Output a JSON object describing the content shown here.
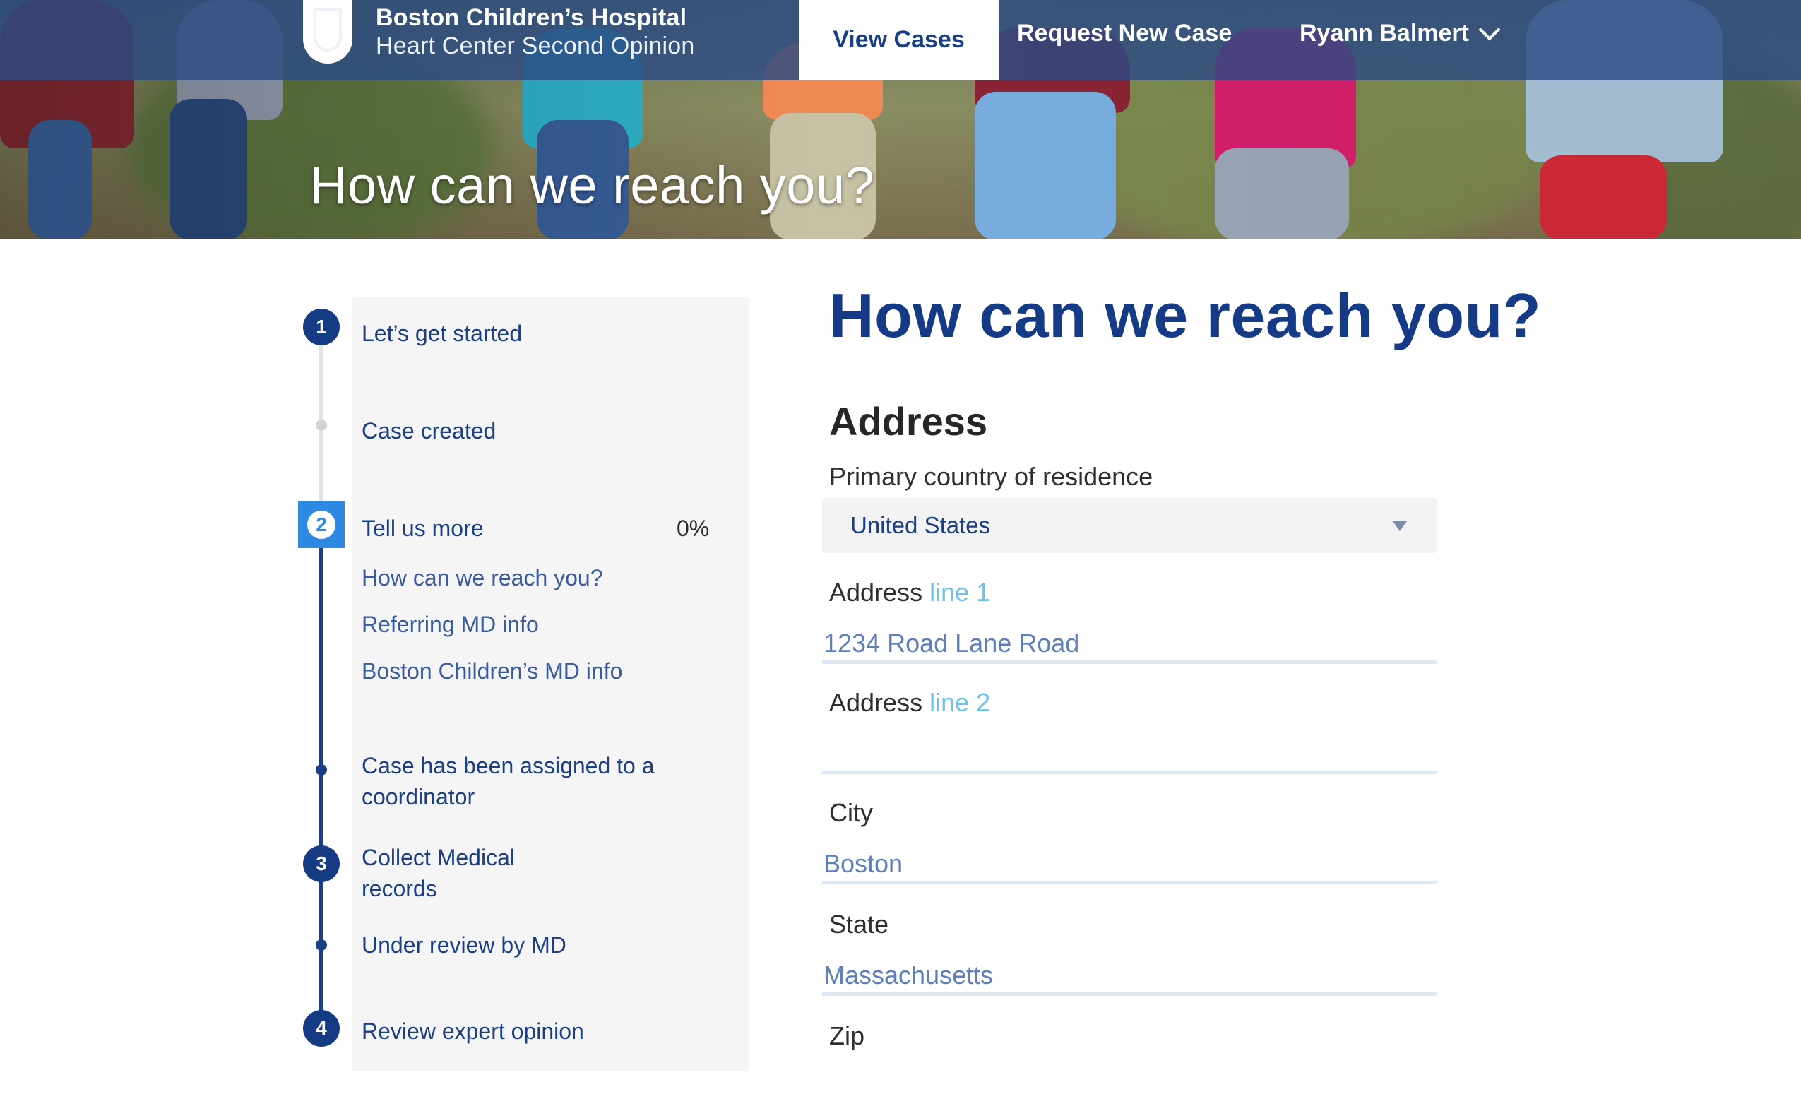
{
  "header": {
    "brand_line1": "Boston Children’s Hospital",
    "brand_line2": "Heart Center Second Opinion",
    "nav": {
      "view_cases": "View Cases",
      "request_new_case": "Request New Case",
      "user_name": "Ryann Balmert"
    },
    "hero_title": "How can we reach you?"
  },
  "stepper": {
    "steps": [
      {
        "number": "1",
        "label": "Let’s get started"
      },
      {
        "label": "Case created"
      },
      {
        "number": "2",
        "label": "Tell us more",
        "progress": "0%"
      },
      {
        "label": "How can we reach you?"
      },
      {
        "label": "Referring MD info"
      },
      {
        "label": "Boston Children’s MD info"
      },
      {
        "label_line1": "Case has been assigned to a",
        "label_line2": "coordinator"
      },
      {
        "number": "3",
        "label_line1": "Collect Medical",
        "label_line2": "records"
      },
      {
        "label": "Under review by MD"
      },
      {
        "number": "4",
        "label": "Review expert opinion"
      }
    ]
  },
  "form": {
    "title": "How can we reach you?",
    "section": "Address",
    "country": {
      "label": "Primary country of residence",
      "value": "United States"
    },
    "address1": {
      "label": "Address",
      "label_accent": "line 1",
      "value": "1234 Road Lane Road"
    },
    "address2": {
      "label": "Address",
      "label_accent": "line 2",
      "value": ""
    },
    "city": {
      "label": "City",
      "value": "Boston"
    },
    "state": {
      "label": "State",
      "value": "Massachusetts"
    },
    "zip": {
      "label": "Zip"
    }
  },
  "colors": {
    "brand_blue": "#153a86",
    "nav_bar": "#2c4a82",
    "active_step": "#2e89e3",
    "accent_light_blue": "#6cc0ea"
  }
}
